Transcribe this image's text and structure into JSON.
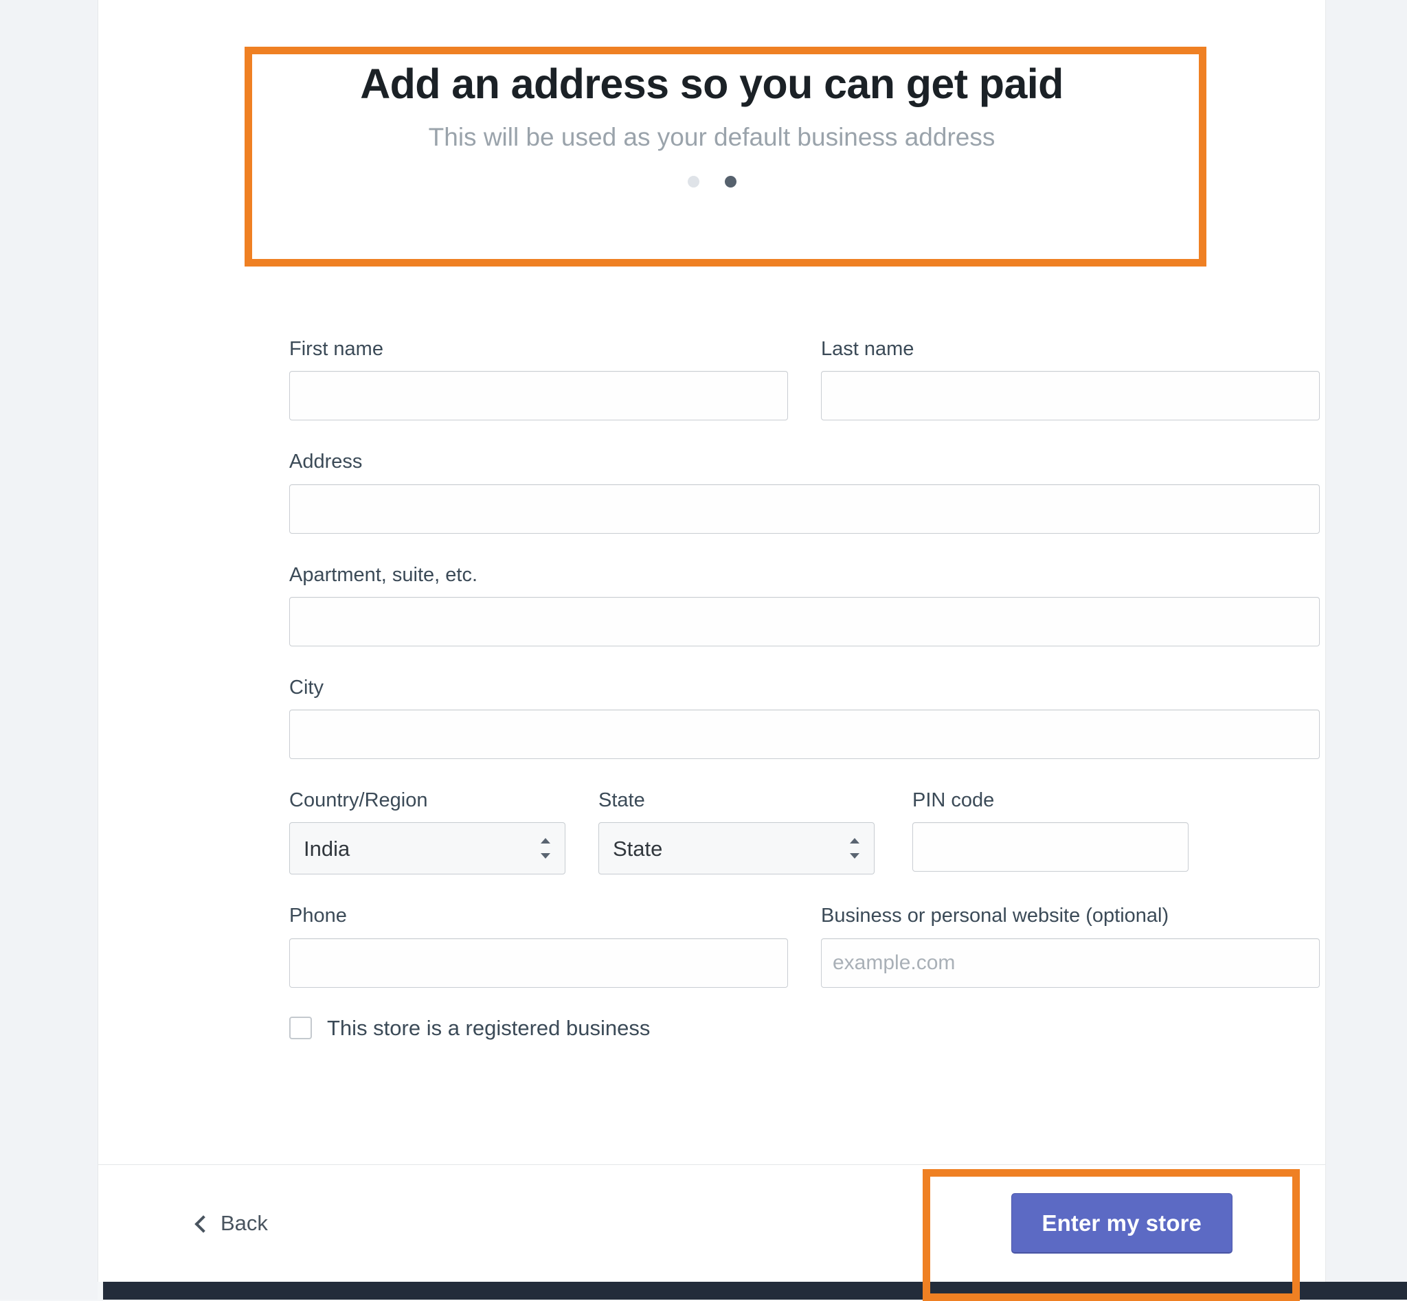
{
  "header": {
    "title": "Add an address so you can get paid",
    "subtitle": "This will be used as your default business address",
    "pagination": {
      "total_dots": 2,
      "active_index": 1
    }
  },
  "form": {
    "first_name": {
      "label": "First name",
      "value": "",
      "placeholder": ""
    },
    "last_name": {
      "label": "Last name",
      "value": "",
      "placeholder": ""
    },
    "address": {
      "label": "Address",
      "value": "",
      "placeholder": ""
    },
    "apartment": {
      "label": "Apartment, suite, etc.",
      "value": "",
      "placeholder": ""
    },
    "city": {
      "label": "City",
      "value": "",
      "placeholder": ""
    },
    "country": {
      "label": "Country/Region",
      "value": "India"
    },
    "state": {
      "label": "State",
      "value": "State"
    },
    "pin_code": {
      "label": "PIN code",
      "value": "",
      "placeholder": ""
    },
    "phone": {
      "label": "Phone",
      "value": "",
      "placeholder": ""
    },
    "website": {
      "label": "Business or personal website (optional)",
      "value": "",
      "placeholder": "example.com"
    },
    "registered_business": {
      "label": "This store is a registered business",
      "checked": false
    }
  },
  "footer": {
    "back_label": "Back",
    "primary_label": "Enter my store"
  },
  "colors": {
    "highlight": "#ef8023",
    "primary_button": "#5c6ac4",
    "page_background": "#f1f3f6",
    "card_background": "#ffffff",
    "bottom_bar": "#232c3a",
    "active_dot": "#56616d",
    "inactive_dot": "#dfe3e8"
  }
}
